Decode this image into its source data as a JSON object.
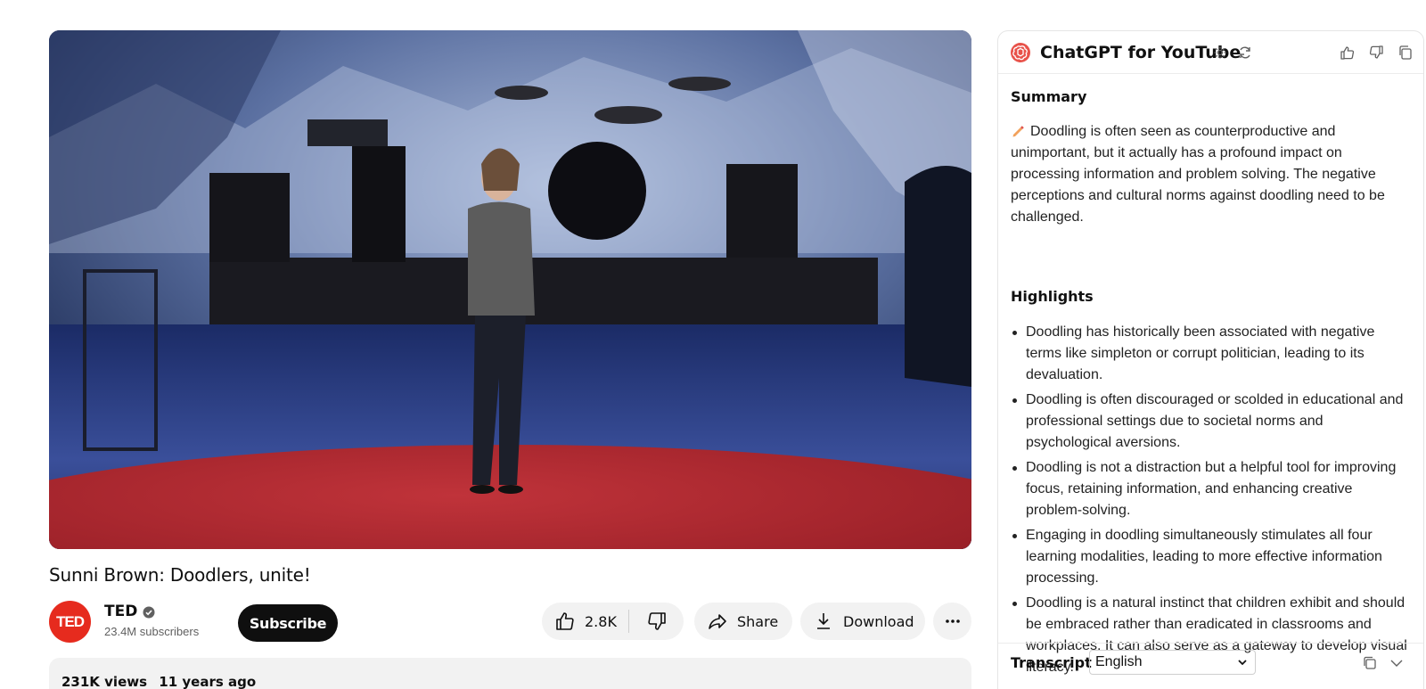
{
  "video": {
    "title": "Sunni Brown: Doodlers, unite!",
    "channel": {
      "name": "TED",
      "avatar_text": "TED",
      "avatar_color": "#e62b1e",
      "subscribers": "23.4M subscribers",
      "verified": true
    },
    "actions": {
      "subscribe_label": "Subscribe",
      "like_count": "2.8K",
      "share_label": "Share",
      "download_label": "Download"
    },
    "description": {
      "views": "231K views",
      "age": "11 years ago"
    }
  },
  "panel": {
    "title": "ChatGPT for YouTube",
    "logo_color": "#e8524a",
    "summary": {
      "heading": "Summary",
      "icon": "pencil-icon",
      "text": "Doodling is often seen as counterproductive and unimportant, but it actually has a profound impact on processing information and problem solving. The negative perceptions and cultural norms against doodling need to be challenged."
    },
    "highlights": {
      "heading": "Highlights",
      "items": [
        "Doodling has historically been associated with negative terms like simpleton or corrupt politician, leading to its devaluation.",
        "Doodling is often discouraged or scolded in educational and professional settings due to societal norms and psychological aversions.",
        "Doodling is not a distraction but a helpful tool for improving focus, retaining information, and enhancing creative problem-solving.",
        "Engaging in doodling simultaneously stimulates all four learning modalities, leading to more effective information processing.",
        "Doodling is a natural instinct that children exhibit and should be embraced rather than eradicated in classrooms and workplaces. It can also serve as a gateway to develop visual literacy."
      ]
    },
    "transcript": {
      "label": "Transcript",
      "language": "English"
    }
  }
}
